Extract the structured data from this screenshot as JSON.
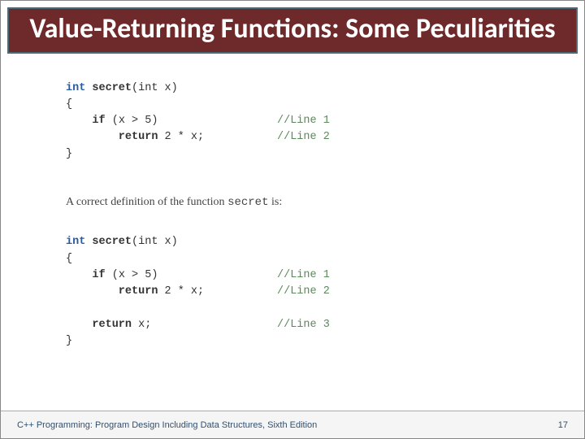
{
  "title": "Value-Returning Functions: Some Peculiarities",
  "code1": {
    "l0_pre": "int ",
    "l0_fn": "secret",
    "l0_post": "(int x)",
    "l1": "{",
    "l2_pre": "    if ",
    "l2_mid": "(x > 5)",
    "l2_cmt": "//Line 1",
    "l3_pre": "        return ",
    "l3_mid": "2 * x;",
    "l3_cmt": "//Line 2",
    "l4": "}"
  },
  "caption": "A correct definition of the function ",
  "caption_code": "secret",
  "caption_post": " is:",
  "code2": {
    "l0_pre": "int ",
    "l0_fn": "secret",
    "l0_post": "(int x)",
    "l1": "{",
    "l2_pre": "    if ",
    "l2_mid": "(x > 5)",
    "l2_cmt": "//Line 1",
    "l3_pre": "        return ",
    "l3_mid": "2 * x;",
    "l3_cmt": "//Line 2",
    "l4_pre": "    return ",
    "l4_mid": "x;",
    "l4_cmt": "//Line 3",
    "l5": "}"
  },
  "footer": "C++ Programming: Program Design Including Data Structures, Sixth Edition",
  "page": "17"
}
